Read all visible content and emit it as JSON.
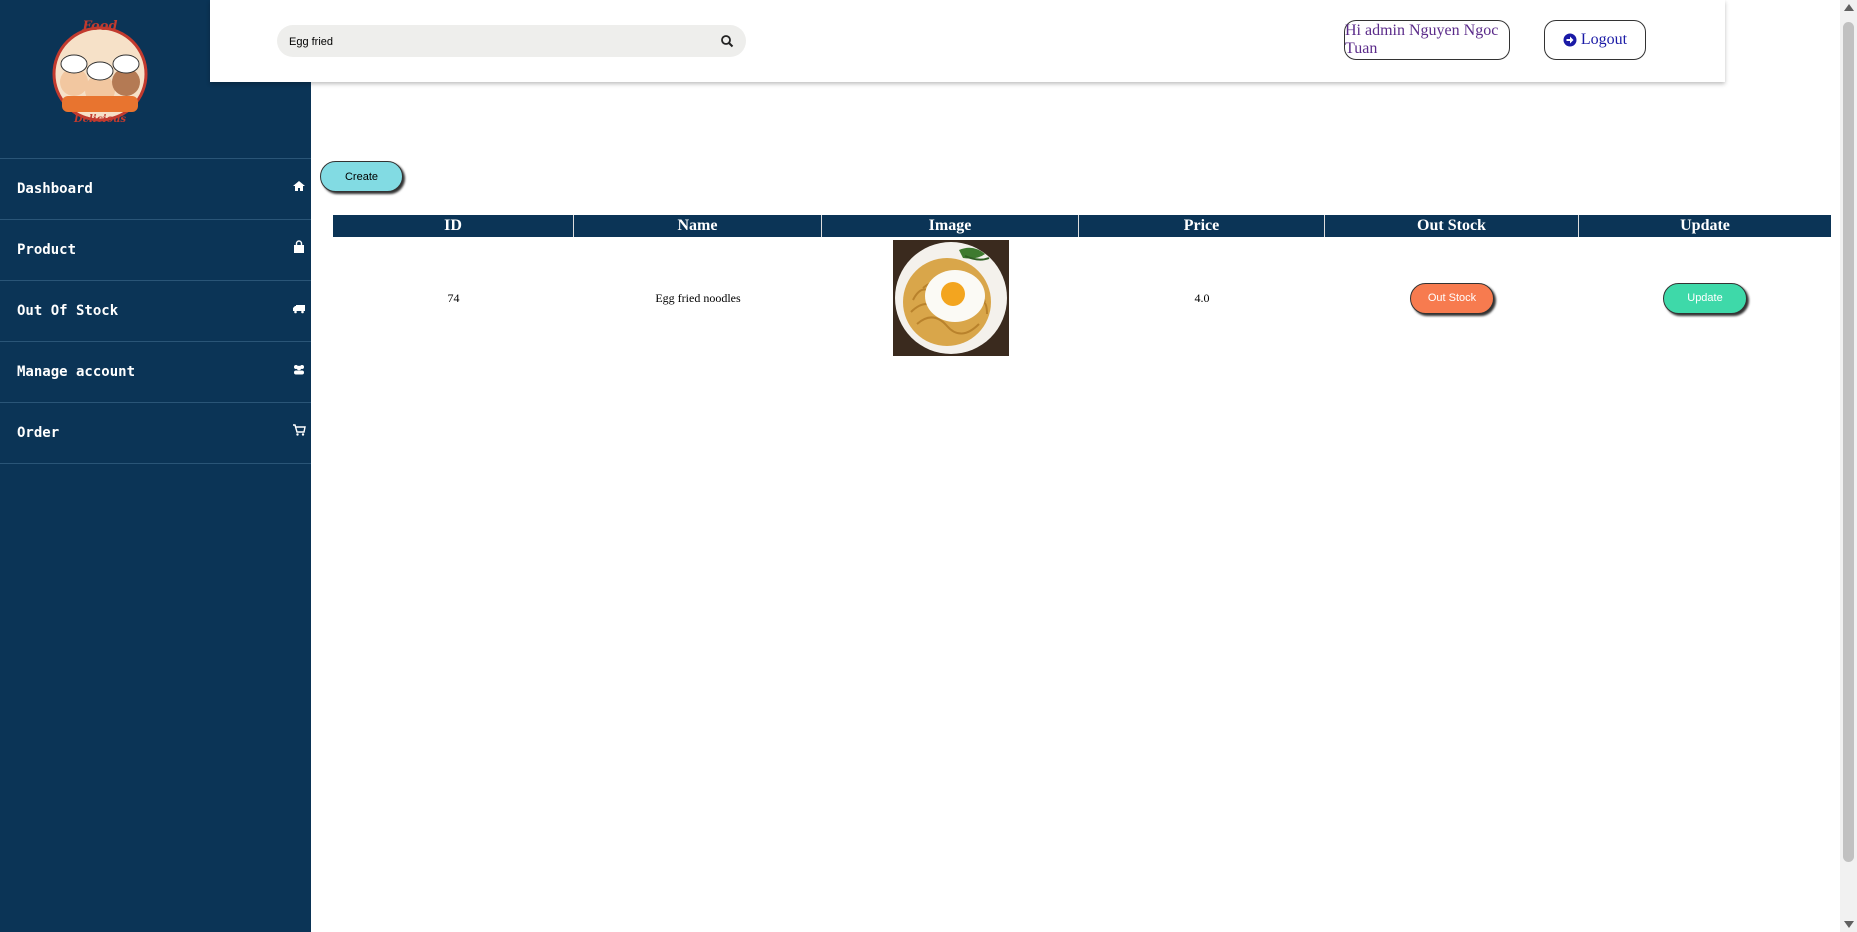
{
  "colors": {
    "sidebar_bg": "#0b3456",
    "table_header_bg": "#0b3456",
    "create_button": "#82dbe3",
    "out_stock_button": "#f77b4f",
    "update_button": "#3ed9a9",
    "greeting_text": "#5b2b8a",
    "logout_text": "#1a1aa6"
  },
  "logo": {
    "text_top": "Food",
    "text_bottom": "Delicious"
  },
  "sidebar": {
    "items": [
      {
        "label": "Dashboard",
        "icon": "home-icon"
      },
      {
        "label": "Product",
        "icon": "shopping-bag-icon"
      },
      {
        "label": "Out Of Stock",
        "icon": "truck-icon"
      },
      {
        "label": "Manage account",
        "icon": "users-icon"
      },
      {
        "label": "Order",
        "icon": "cart-icon"
      }
    ]
  },
  "header": {
    "search": {
      "value": "Egg fried",
      "icon": "search-icon"
    },
    "greeting": "Hi admin Nguyen Ngoc Tuan",
    "logout_label": "Logout",
    "logout_icon": "arrow-circle-right-icon"
  },
  "main": {
    "create_label": "Create",
    "table": {
      "columns": [
        "ID",
        "Name",
        "Image",
        "Price",
        "Out Stock",
        "Update"
      ],
      "rows": [
        {
          "id": "74",
          "name": "Egg fried noodles",
          "price": "4.0",
          "out_stock_label": "Out Stock",
          "update_label": "Update"
        }
      ]
    }
  }
}
